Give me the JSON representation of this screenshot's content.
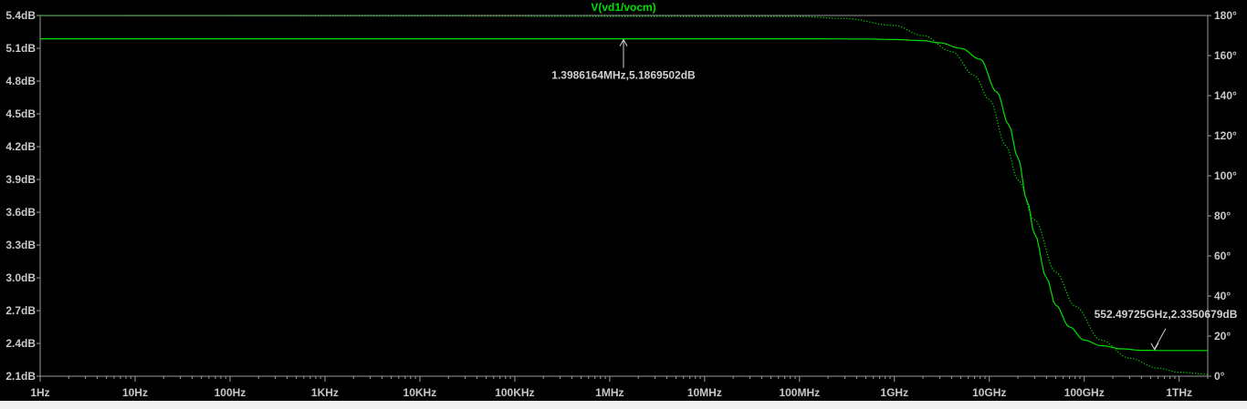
{
  "chart_data": {
    "type": "line",
    "title": "V(vd1/vocm)",
    "x_scale": "log",
    "xlim": [
      1,
      2000000000000
    ],
    "x_ticks": [
      {
        "value": 1,
        "label": "1Hz"
      },
      {
        "value": 10,
        "label": "10Hz"
      },
      {
        "value": 100,
        "label": "100Hz"
      },
      {
        "value": 1000,
        "label": "1KHz"
      },
      {
        "value": 10000,
        "label": "10KHz"
      },
      {
        "value": 100000,
        "label": "100KHz"
      },
      {
        "value": 1000000,
        "label": "1MHz"
      },
      {
        "value": 10000000,
        "label": "10MHz"
      },
      {
        "value": 100000000,
        "label": "100MHz"
      },
      {
        "value": 1000000000,
        "label": "1GHz"
      },
      {
        "value": 10000000000,
        "label": "10GHz"
      },
      {
        "value": 100000000000,
        "label": "100GHz"
      },
      {
        "value": 1000000000000,
        "label": "1THz"
      }
    ],
    "ylim_left": [
      2.1,
      5.4
    ],
    "y_ticks_left": [
      {
        "value": 5.4,
        "label": "5.4dB"
      },
      {
        "value": 5.1,
        "label": "5.1dB"
      },
      {
        "value": 4.8,
        "label": "4.8dB"
      },
      {
        "value": 4.5,
        "label": "4.5dB"
      },
      {
        "value": 4.2,
        "label": "4.2dB"
      },
      {
        "value": 3.9,
        "label": "3.9dB"
      },
      {
        "value": 3.6,
        "label": "3.6dB"
      },
      {
        "value": 3.3,
        "label": "3.3dB"
      },
      {
        "value": 3.0,
        "label": "3.0dB"
      },
      {
        "value": 2.7,
        "label": "2.7dB"
      },
      {
        "value": 2.4,
        "label": "2.4dB"
      },
      {
        "value": 2.1,
        "label": "2.1dB"
      }
    ],
    "ylim_right": [
      0,
      180
    ],
    "y_ticks_right": [
      {
        "value": 180,
        "label": "180°"
      },
      {
        "value": 160,
        "label": "160°"
      },
      {
        "value": 140,
        "label": "140°"
      },
      {
        "value": 120,
        "label": "120°"
      },
      {
        "value": 100,
        "label": "100°"
      },
      {
        "value": 80,
        "label": "80°"
      },
      {
        "value": 60,
        "label": "60°"
      },
      {
        "value": 40,
        "label": "40°"
      },
      {
        "value": 20,
        "label": "20°"
      },
      {
        "value": 0,
        "label": "0°"
      }
    ],
    "grid": false,
    "series": [
      {
        "name": "V(vd1/vocm)",
        "kind": "magnitude",
        "axis": "left",
        "color": "#00e000",
        "style": "solid",
        "x": [
          1,
          100000000,
          500000000,
          1000000000,
          2000000000,
          3000000000,
          5000000000,
          8000000000,
          12000000000,
          16000000000,
          20000000000,
          25000000000,
          30000000000,
          40000000000,
          50000000000,
          70000000000,
          100000000000,
          150000000000,
          250000000000,
          400000000000,
          700000000000,
          1000000000000,
          2000000000000
        ],
        "y": [
          5.187,
          5.187,
          5.185,
          5.18,
          5.17,
          5.15,
          5.1,
          5.0,
          4.7,
          4.4,
          4.1,
          3.7,
          3.4,
          3.0,
          2.75,
          2.55,
          2.43,
          2.38,
          2.35,
          2.337,
          2.335,
          2.335,
          2.335
        ]
      },
      {
        "name": "V(vd1/vocm)",
        "kind": "phase",
        "axis": "right",
        "color": "#00e000",
        "style": "dotted",
        "x": [
          1,
          100000000,
          300000000,
          1000000000,
          2000000000,
          4000000000,
          7000000000,
          10000000000,
          15000000000,
          20000000000,
          30000000000,
          50000000000,
          80000000000,
          150000000000,
          300000000000,
          600000000000,
          1000000000000,
          2000000000000
        ],
        "y": [
          179.9,
          179.5,
          178.5,
          175,
          170,
          162,
          150,
          138,
          115,
          98,
          78,
          52,
          35,
          18,
          9,
          4,
          2,
          1
        ]
      }
    ],
    "annotations": [
      {
        "text": "1.3986164MHz,5.1869502dB",
        "x": 1398616.4,
        "y": 5.1869502
      },
      {
        "text": "552.49725GHz,2.3350679dB",
        "x": 552497250000,
        "y": 2.3350679
      }
    ]
  }
}
